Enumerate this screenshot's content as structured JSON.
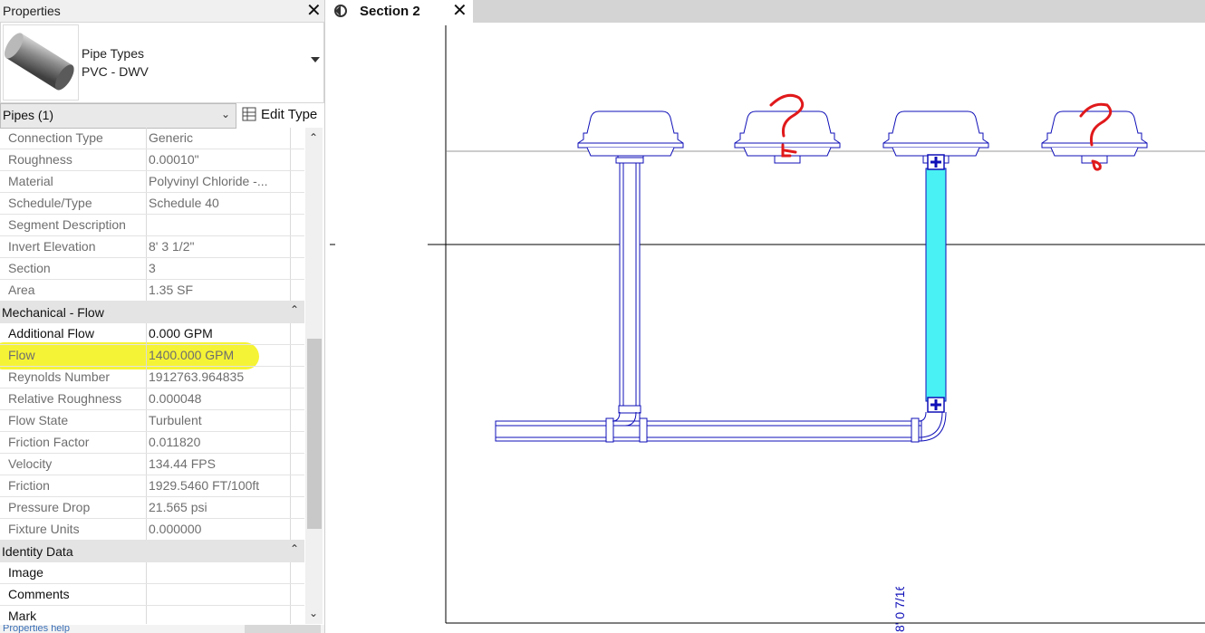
{
  "properties": {
    "title": "Properties",
    "type_family": "Pipe Types",
    "type_name": "PVC - DWV",
    "filter": "Pipes (1)",
    "edit_type_label": "Edit Type",
    "rows_top": [
      {
        "label": "Connection Type",
        "value": "Generic"
      },
      {
        "label": "Roughness",
        "value": "0.00010\""
      },
      {
        "label": "Material",
        "value": "Polyvinyl Chloride -..."
      },
      {
        "label": "Schedule/Type",
        "value": "Schedule 40"
      },
      {
        "label": "Segment Description",
        "value": ""
      },
      {
        "label": "Invert Elevation",
        "value": "8'  3 1/2\""
      },
      {
        "label": "Section",
        "value": "3"
      },
      {
        "label": "Area",
        "value": "1.35 SF"
      }
    ],
    "group_mech": "Mechanical - Flow",
    "rows_mech": [
      {
        "label": "Additional Flow",
        "value": "0.000 GPM"
      },
      {
        "label": "Flow",
        "value": "1400.000 GPM"
      },
      {
        "label": "Reynolds Number",
        "value": "1912763.964835"
      },
      {
        "label": "Relative Roughness",
        "value": "0.000048"
      },
      {
        "label": "Flow State",
        "value": "Turbulent"
      },
      {
        "label": "Friction Factor",
        "value": "0.011820"
      },
      {
        "label": "Velocity",
        "value": "134.44 FPS"
      },
      {
        "label": "Friction",
        "value": "1929.5460 FT/100ft"
      },
      {
        "label": "Pressure Drop",
        "value": "21.565 psi"
      },
      {
        "label": "Fixture Units",
        "value": "0.000000"
      }
    ],
    "group_identity": "Identity Data",
    "rows_identity": [
      {
        "label": "Image",
        "value": ""
      },
      {
        "label": "Comments",
        "value": ""
      },
      {
        "label": "Mark",
        "value": ""
      }
    ],
    "footer_link": "Properties help",
    "highlight_color": "#f4f21f"
  },
  "view": {
    "tab_title": "Section 2",
    "dimension_text": "8' 0 7/16\"",
    "annotation_text": "?",
    "annotation_color": "#e0191b",
    "pipe_color": "#0f0fb8",
    "selected_pipe_fill": "#49f0f4"
  }
}
